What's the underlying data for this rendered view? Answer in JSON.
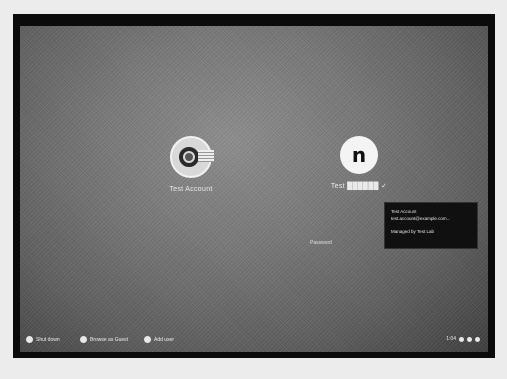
{
  "login_screen": {
    "users": [
      {
        "name": "Test Account",
        "avatar_icon": "camera-lens-icon"
      },
      {
        "name": "Test ██████ ✓",
        "avatar_icon": "profile-glyph-icon",
        "avatar_glyph": "n"
      }
    ],
    "password_prompt": "Password",
    "tooltip": {
      "line1": "Test Account",
      "line2": "test.account@example.com...",
      "line3": "Managed by Test Lab"
    }
  },
  "shelf": {
    "items": [
      {
        "label": "Shut down",
        "icon": "power-icon"
      },
      {
        "label": "Browse as Guest",
        "icon": "guest-icon"
      },
      {
        "label": "Add user",
        "icon": "add-user-icon"
      }
    ],
    "tray_time": "1:04"
  }
}
